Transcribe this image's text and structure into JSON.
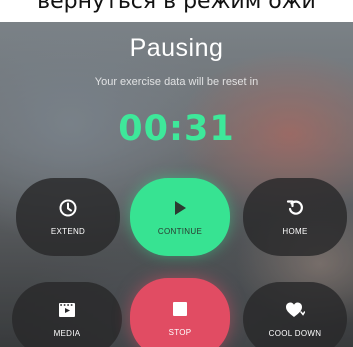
{
  "caption": {
    "text": "вернуться в режим ожи"
  },
  "screen": {
    "title": "Pausing",
    "subtitle": "Your exercise data will be reset in",
    "timer": "00:31"
  },
  "buttons": {
    "extend": {
      "label": "EXTEND",
      "icon": "clock-icon"
    },
    "continue": {
      "label": "CONTINUE",
      "icon": "play-icon"
    },
    "home": {
      "label": "HOME",
      "icon": "return-arrow-icon"
    },
    "media": {
      "label": "MEDIA",
      "icon": "film-icon"
    },
    "stop": {
      "label": "STOP",
      "icon": "stop-icon"
    },
    "cooldown": {
      "label": "COOL DOWN",
      "icon": "heart-icon"
    }
  },
  "colors": {
    "timer": "#3ee89a",
    "continue": "#37e392",
    "stop": "#e14c63",
    "dark_button": "#28282a"
  }
}
